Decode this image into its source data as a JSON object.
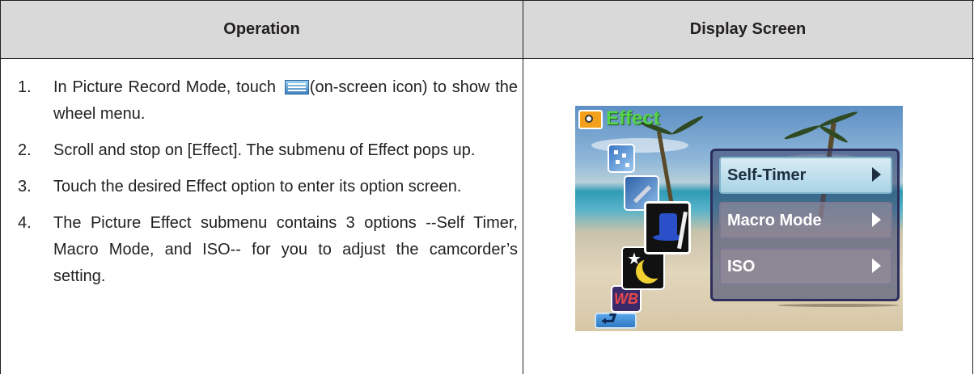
{
  "table": {
    "header_operation": "Operation",
    "header_display": "Display Screen"
  },
  "steps": [
    {
      "num": "1.",
      "before_icon": "In Picture Record Mode, touch ",
      "icon": "menu-list-icon",
      "after_icon": "(on-screen icon) to show the wheel menu."
    },
    {
      "num": "2.",
      "text": "Scroll and stop on [Effect]. The submenu of Effect pops up."
    },
    {
      "num": "3.",
      "text": "Touch the desired Effect option to enter its option screen."
    },
    {
      "num": "4.",
      "text": "The Picture Effect submenu contains 3 options --Self Timer, Macro Mode, and ISO-- for you to adjust the camcorder’s setting."
    }
  ],
  "screen": {
    "title": "Effect",
    "title_color": "#55d34a",
    "menu_items": [
      {
        "label": "Self-Timer",
        "selected": true
      },
      {
        "label": "Macro Mode",
        "selected": false
      },
      {
        "label": "ISO",
        "selected": false
      }
    ],
    "side_icons": [
      "effect-icon",
      "tool-icon",
      "magic-hat-icon",
      "night-mode-icon",
      "white-balance-icon"
    ],
    "wb_text": "WB"
  },
  "colors": {
    "header_bg": "#d9d9d9",
    "text": "#231f20",
    "border": "#231f20"
  }
}
